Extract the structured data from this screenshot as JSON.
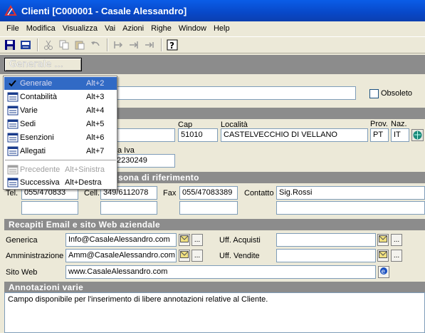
{
  "window": {
    "title": "Clienti [C000001 - Casale Alessandro]"
  },
  "menu": [
    "File",
    "Modifica",
    "Visualizza",
    "Vai",
    "Azioni",
    "Righe",
    "Window",
    "Help"
  ],
  "section_selector": {
    "value": "Generale ..."
  },
  "popup": {
    "items": [
      {
        "label": "Generale",
        "shortcut": "Alt+2",
        "icon": "check-icon",
        "state": "selected"
      },
      {
        "label": "Contabilità",
        "shortcut": "Alt+3",
        "icon": "form-icon",
        "state": "normal"
      },
      {
        "label": "Varie",
        "shortcut": "Alt+4",
        "icon": "form-icon",
        "state": "normal"
      },
      {
        "label": "Sedi",
        "shortcut": "Alt+5",
        "icon": "form-icon",
        "state": "normal"
      },
      {
        "label": "Esenzioni",
        "shortcut": "Alt+6",
        "icon": "form-icon",
        "state": "normal"
      },
      {
        "label": "Allegati",
        "shortcut": "Alt+7",
        "icon": "form-icon",
        "state": "normal"
      },
      {
        "label": "Precedente",
        "shortcut": "Alt+Sinistra",
        "icon": "prev-icon",
        "state": "disabled"
      },
      {
        "label": "Successiva",
        "shortcut": "Alt+Destra",
        "icon": "next-icon",
        "state": "normal"
      }
    ]
  },
  "form": {
    "obsoleto_label": "Obsoleto",
    "cap_label": "Cap",
    "cap_value": "51010",
    "localita_label": "Località",
    "localita_value": "CASTELVECCHIO DI VELLANO",
    "prov_label": "Prov.",
    "prov_value": "PT",
    "naz_label": "Naz.",
    "naz_value": "IT",
    "piva_label_partial": "a Iva",
    "piva_value_partial": "2230249",
    "persona_header_partial": "sona di riferimento",
    "tel_label_partial": "Tel.",
    "tel_value_partial": "055/470833",
    "cell_label_partial": "Cell.",
    "cell_value": "349/6112078",
    "fax_label": "Fax",
    "fax_value": "055/47083389",
    "contatto_label": "Contatto",
    "contatto_value": "Sig.Rossi",
    "recapiti_header": "Recapiti Email e sito Web aziendale",
    "generica_label": "Generica",
    "generica_value": "Info@CasaleAlessandro.com",
    "amministrazione_label": "Amministrazione",
    "amministrazione_value": "Amm@CasaleAlessandro.com",
    "uff_acquisti_label": "Uff. Acquisti",
    "uff_vendite_label": "Uff. Vendite",
    "sito_web_label": "Sito Web",
    "sito_web_value": "www.CasaleAlessandro.com",
    "annotazioni_header": "Annotazioni varie",
    "annotazioni_text": "Campo disponibile per l'inserimento di libere annotazioni relative al Cliente.",
    "dots": "..."
  }
}
